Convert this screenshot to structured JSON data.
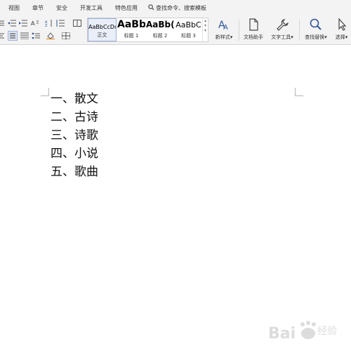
{
  "menu": {
    "items": [
      "视图",
      "章节",
      "安全",
      "开发工具",
      "特色应用"
    ],
    "search_label": "查找命令、搜索模板"
  },
  "ribbon": {
    "styles": [
      {
        "preview": "AaBbCcDd",
        "label": "正文",
        "selected": true
      },
      {
        "preview": "AaBb",
        "label": "标题 1"
      },
      {
        "preview": "AaBb(",
        "label": "标题 2"
      },
      {
        "preview": "AaBbC",
        "label": "标题 3"
      }
    ],
    "new_style_label": "新样式",
    "doc_helper_label": "文档助手",
    "text_tools_label": "文字工具",
    "find_replace_label": "查找替换",
    "select_label": "选择"
  },
  "document": {
    "list_items": [
      "一、散文",
      "二、古诗",
      "三、诗歌",
      "四、小说",
      "五、歌曲"
    ]
  },
  "watermark": {
    "text": "Baidu 经验"
  },
  "colors": {
    "toolbar_bg": "#f3f3f3",
    "accent": "#2f5597",
    "selected_style_bg": "#e9eef8"
  }
}
